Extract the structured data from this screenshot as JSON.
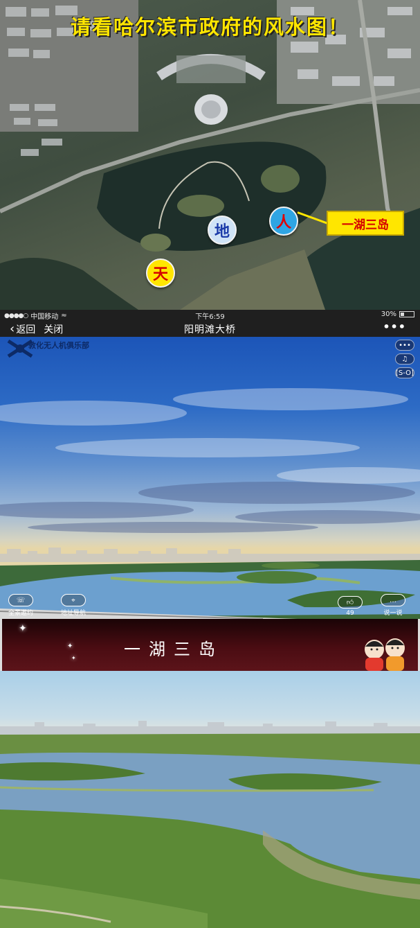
{
  "map": {
    "title": "请看哈尔滨市政府的风水图！",
    "badges": {
      "tian": "天",
      "di": "地",
      "ren": "人"
    },
    "callout": "一湖三岛"
  },
  "phone": {
    "status": {
      "carrier": "中国移动",
      "time": "下午6:59",
      "battery": "30%",
      "battery_level": 0.3
    },
    "nav": {
      "back": "返回",
      "close": "关闭",
      "title": "阳明滩大桥",
      "more": "•••"
    },
    "club_name": "敦化无人机俱乐部",
    "side_buttons": {
      "menu": "•••",
      "music": "♫",
      "vr": "[S-O]"
    },
    "bottom": {
      "tour_label": "全景邀约",
      "nav_label": "地址导航",
      "like_count": "49",
      "comment_label": "说一说"
    }
  },
  "banner": {
    "title": "一湖三岛"
  },
  "colors": {
    "highlight_yellow": "#ffe600",
    "accent_red": "#d50000",
    "banner_bg": "#4a0c12"
  }
}
